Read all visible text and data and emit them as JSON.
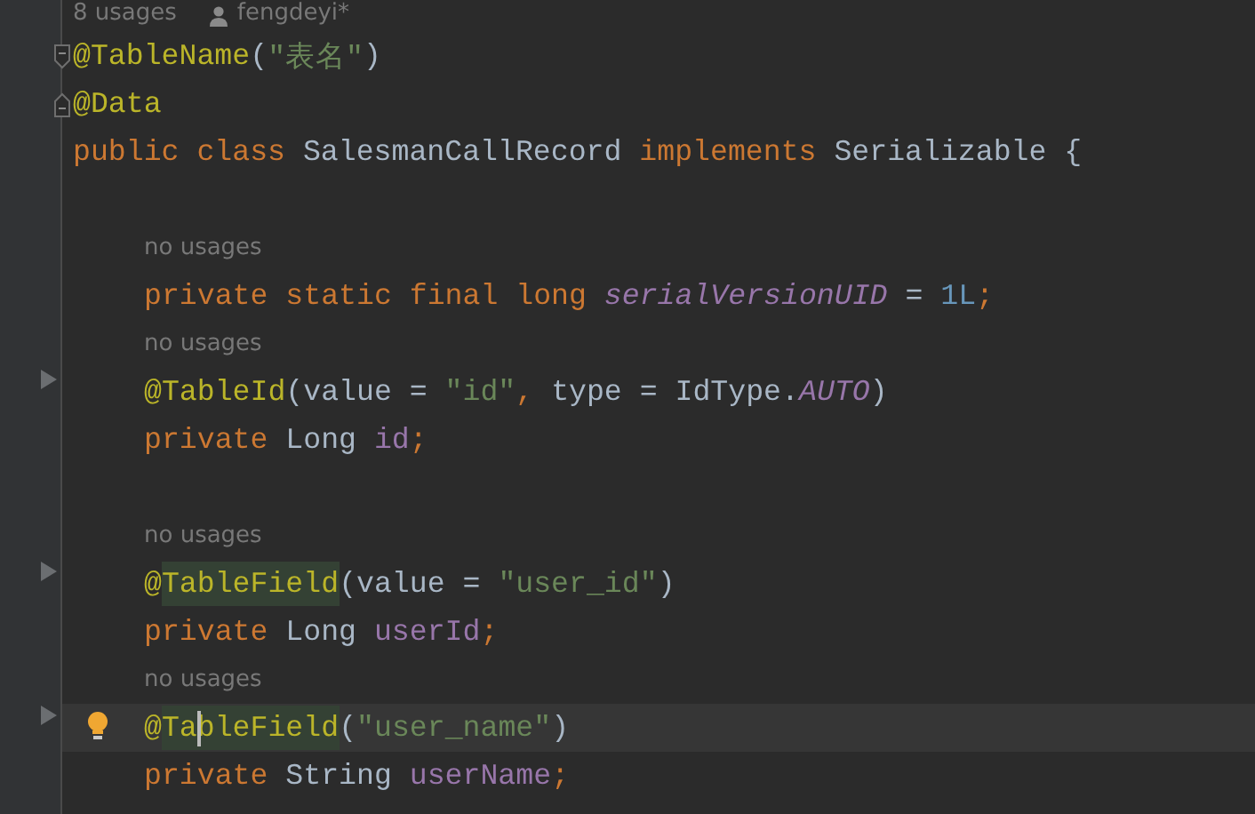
{
  "editor": {
    "lines": [
      {
        "kind": "hint",
        "text": "8 usages",
        "author": "fengdeyi*",
        "indented": false
      },
      {
        "kind": "code",
        "gutter": {
          "kind": "fold-start"
        },
        "indented": false,
        "tokens": [
          {
            "text": "@TableName",
            "kind": "annotation"
          },
          {
            "text": "(",
            "kind": "plain"
          },
          {
            "text": "\"表名\"",
            "kind": "string"
          },
          {
            "text": ")",
            "kind": "plain"
          }
        ]
      },
      {
        "kind": "code",
        "gutter": {
          "kind": "fold-end"
        },
        "indented": false,
        "tokens": [
          {
            "text": "@Data",
            "kind": "annotation"
          }
        ]
      },
      {
        "kind": "code",
        "indented": false,
        "tokens": [
          {
            "text": "public class ",
            "kind": "keyword"
          },
          {
            "text": "SalesmanCallRecord ",
            "kind": "plain"
          },
          {
            "text": "implements ",
            "kind": "keyword"
          },
          {
            "text": "Serializable {",
            "kind": "plain"
          }
        ]
      },
      {
        "kind": "blank"
      },
      {
        "kind": "hint",
        "text": "no usages",
        "indented": true
      },
      {
        "kind": "code",
        "indented": true,
        "tokens": [
          {
            "text": "private static final long ",
            "kind": "keyword"
          },
          {
            "text": "serialVersionUID",
            "kind": "static"
          },
          {
            "text": " = ",
            "kind": "plain"
          },
          {
            "text": "1L",
            "kind": "number"
          },
          {
            "text": ";",
            "kind": "keyword"
          }
        ]
      },
      {
        "kind": "hint",
        "text": "no usages",
        "indented": true
      },
      {
        "kind": "code",
        "gutter": {
          "kind": "run"
        },
        "indented": true,
        "tokens": [
          {
            "text": "@TableId",
            "kind": "annotation"
          },
          {
            "text": "(value = ",
            "kind": "plain"
          },
          {
            "text": "\"id\"",
            "kind": "string"
          },
          {
            "text": ", ",
            "kind": "keyword"
          },
          {
            "text": "type = IdType.",
            "kind": "plain"
          },
          {
            "text": "AUTO",
            "kind": "static"
          },
          {
            "text": ")",
            "kind": "plain"
          }
        ]
      },
      {
        "kind": "code",
        "indented": true,
        "tokens": [
          {
            "text": "private ",
            "kind": "keyword"
          },
          {
            "text": "Long ",
            "kind": "plain"
          },
          {
            "text": "id",
            "kind": "field"
          },
          {
            "text": ";",
            "kind": "keyword"
          }
        ]
      },
      {
        "kind": "blank"
      },
      {
        "kind": "hint",
        "text": "no usages",
        "indented": true
      },
      {
        "kind": "code",
        "gutter": {
          "kind": "run"
        },
        "indented": true,
        "tokens": [
          {
            "text": "@",
            "kind": "annotation"
          },
          {
            "text": "TableField",
            "kind": "annotation",
            "highlighted": true
          },
          {
            "text": "(value = ",
            "kind": "plain"
          },
          {
            "text": "\"user_id\"",
            "kind": "string"
          },
          {
            "text": ")",
            "kind": "plain"
          }
        ]
      },
      {
        "kind": "code",
        "indented": true,
        "tokens": [
          {
            "text": "private ",
            "kind": "keyword"
          },
          {
            "text": "Long ",
            "kind": "plain"
          },
          {
            "text": "userId",
            "kind": "field"
          },
          {
            "text": ";",
            "kind": "keyword"
          }
        ]
      },
      {
        "kind": "hint",
        "text": "no usages",
        "indented": true
      },
      {
        "kind": "code",
        "gutter": {
          "kind": "run"
        },
        "indented": true,
        "current": true,
        "bulb": true,
        "tokens": [
          {
            "text": "@",
            "kind": "annotation"
          },
          {
            "text": "Ta",
            "kind": "annotation",
            "highlighted": true,
            "caret_after": true
          },
          {
            "text": "bleField",
            "kind": "annotation",
            "highlighted": true
          },
          {
            "text": "(",
            "kind": "plain"
          },
          {
            "text": "\"user_name\"",
            "kind": "string"
          },
          {
            "text": ")",
            "kind": "plain"
          }
        ]
      },
      {
        "kind": "code",
        "indented": true,
        "tokens": [
          {
            "text": "private ",
            "kind": "keyword"
          },
          {
            "text": "String ",
            "kind": "plain"
          },
          {
            "text": "userName",
            "kind": "field"
          },
          {
            "text": ";",
            "kind": "keyword"
          }
        ]
      }
    ]
  }
}
